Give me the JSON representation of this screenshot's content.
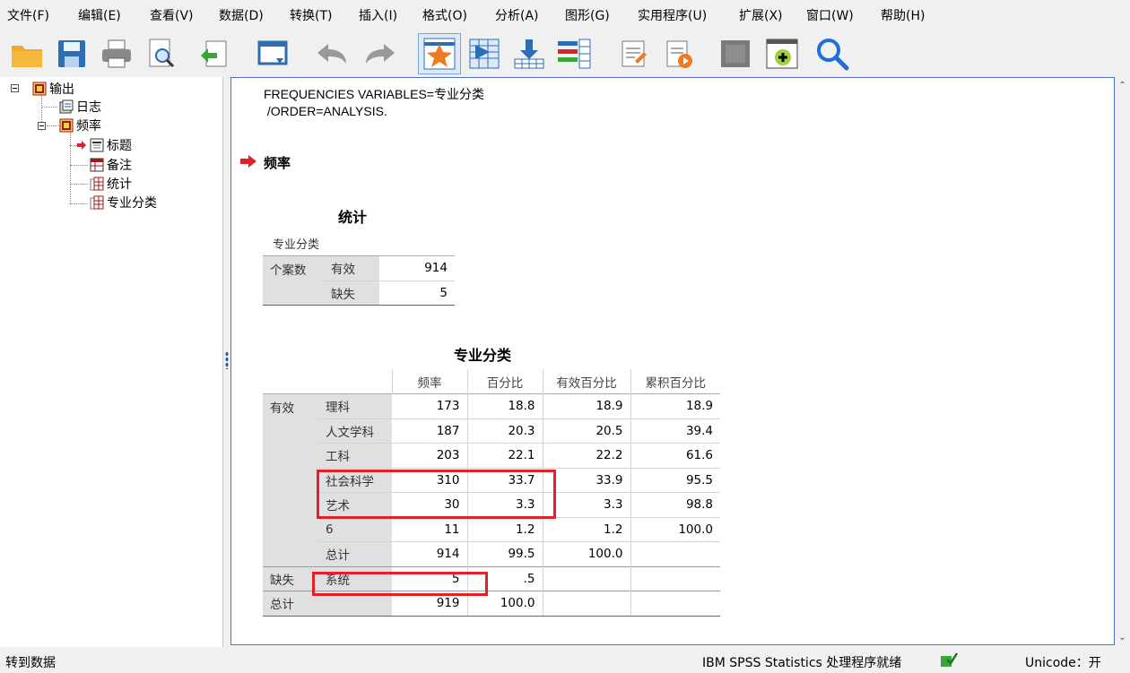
{
  "menu": [
    "文件(F)",
    "编辑(E)",
    "查看(V)",
    "数据(D)",
    "转换(T)",
    "插入(I)",
    "格式(O)",
    "分析(A)",
    "图形(G)",
    "实用程序(U)",
    "扩展(X)",
    "窗口(W)",
    "帮助(H)"
  ],
  "outline": {
    "root": "输出",
    "log": "日志",
    "freq": "频率",
    "title": "标题",
    "notes": "备注",
    "stats": "统计",
    "major": "专业分类"
  },
  "syntax": {
    "line1": "FREQUENCIES VARIABLES=专业分类",
    "line2": " /ORDER=ANALYSIS."
  },
  "section_title": "频率",
  "stats_table": {
    "title": "统计",
    "var_label": "专业分类",
    "group": "个案数",
    "rows": [
      {
        "label": "有效",
        "value": "914"
      },
      {
        "label": "缺失",
        "value": "5"
      }
    ]
  },
  "freq_table": {
    "title": "专业分类",
    "headers": [
      "频率",
      "百分比",
      "有效百分比",
      "累积百分比"
    ],
    "valid_group": "有效",
    "missing_group": "缺失",
    "total_group": "总计",
    "valid_rows": [
      {
        "label": "理科",
        "freq": "173",
        "pct": "18.8",
        "vpct": "18.9",
        "cpct": "18.9"
      },
      {
        "label": "人文学科",
        "freq": "187",
        "pct": "20.3",
        "vpct": "20.5",
        "cpct": "39.4"
      },
      {
        "label": "工科",
        "freq": "203",
        "pct": "22.1",
        "vpct": "22.2",
        "cpct": "61.6"
      },
      {
        "label": "社会科学",
        "freq": "310",
        "pct": "33.7",
        "vpct": "33.9",
        "cpct": "95.5"
      },
      {
        "label": "艺术",
        "freq": "30",
        "pct": "3.3",
        "vpct": "3.3",
        "cpct": "98.8"
      },
      {
        "label": "6",
        "freq": "11",
        "pct": "1.2",
        "vpct": "1.2",
        "cpct": "100.0"
      },
      {
        "label": "总计",
        "freq": "914",
        "pct": "99.5",
        "vpct": "100.0",
        "cpct": ""
      }
    ],
    "missing_row": {
      "label": "系统",
      "freq": "5",
      "pct": ".5"
    },
    "total_row": {
      "freq": "919",
      "pct": "100.0"
    }
  },
  "status": {
    "left": "转到数据",
    "processor": "IBM SPSS Statistics 处理程序就绪",
    "unicode": "Unicode：开"
  },
  "colors": {
    "accent": "#2a5dbf",
    "highlight": "#e0212a",
    "arrow": "#e0212a"
  }
}
